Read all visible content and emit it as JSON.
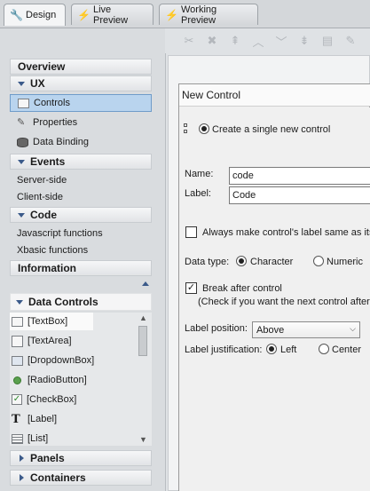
{
  "tabs": [
    {
      "label": "Design",
      "icon": "wrench-icon"
    },
    {
      "label": "Live Preview",
      "icon": "lightning-icon"
    },
    {
      "label": "Working Preview",
      "icon": "lightning-icon"
    }
  ],
  "sidebar": {
    "overview": "Overview",
    "ux": "UX",
    "ux_items": [
      {
        "label": "Controls",
        "icon": "controls-icon"
      },
      {
        "label": "Properties",
        "icon": "properties-icon"
      },
      {
        "label": "Data Binding",
        "icon": "database-icon"
      }
    ],
    "events": "Events",
    "events_items": [
      "Server-side",
      "Client-side"
    ],
    "code": "Code",
    "code_items": [
      "Javascript functions",
      "Xbasic functions"
    ],
    "information": "Information",
    "data_controls": "Data Controls",
    "data_controls_items": [
      {
        "label": "[TextBox]",
        "icon": "textbox-icon"
      },
      {
        "label": "[TextArea]",
        "icon": "textarea-icon"
      },
      {
        "label": "[DropdownBox]",
        "icon": "dropdown-icon"
      },
      {
        "label": "[RadioButton]",
        "icon": "radio-icon"
      },
      {
        "label": "[CheckBox]",
        "icon": "checkbox-icon"
      },
      {
        "label": "[Label]",
        "icon": "label-icon"
      },
      {
        "label": "[List]",
        "icon": "list-icon"
      }
    ],
    "panels": "Panels",
    "containers": "Containers"
  },
  "dialog": {
    "title": "New Control",
    "create_single": "Create a single new control",
    "name_label": "Name:",
    "name_value": "code",
    "label_label": "Label:",
    "label_value": "Code",
    "same_label_checkbox": "Always make control's label same as its",
    "data_type_label": "Data type:",
    "data_type_character": "Character",
    "data_type_numeric": "Numeric",
    "break_after": "Break after control",
    "break_hint": "(Check if you want the next control after",
    "label_position_label": "Label position:",
    "label_position_value": "Above",
    "label_justification_label": "Label justification:",
    "justify_left": "Left",
    "justify_center": "Center"
  }
}
